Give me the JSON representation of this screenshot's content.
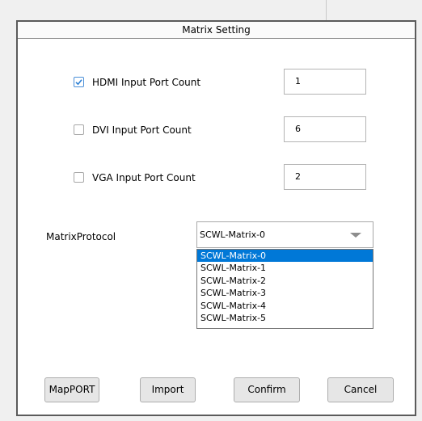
{
  "dialog": {
    "title": "Matrix Setting"
  },
  "ports": [
    {
      "label": "HDMI Input Port Count",
      "checked": true,
      "value": "1"
    },
    {
      "label": "DVI Input Port Count",
      "checked": false,
      "value": "6"
    },
    {
      "label": "VGA Input Port Count",
      "checked": false,
      "value": "2"
    }
  ],
  "protocol": {
    "label": "MatrixProtocol",
    "selected": "SCWL-Matrix-0",
    "options": [
      "SCWL-Matrix-0",
      "SCWL-Matrix-1",
      "SCWL-Matrix-2",
      "SCWL-Matrix-3",
      "SCWL-Matrix-4",
      "SCWL-Matrix-5"
    ],
    "highlighted_index": 0
  },
  "buttons": {
    "mapport": "MapPORT",
    "import": "Import",
    "confirm": "Confirm",
    "cancel": "Cancel"
  },
  "colors": {
    "selection": "#0078d7",
    "checkbox_accent": "#4a8fd8",
    "dialog_border": "#5b5b5b"
  }
}
